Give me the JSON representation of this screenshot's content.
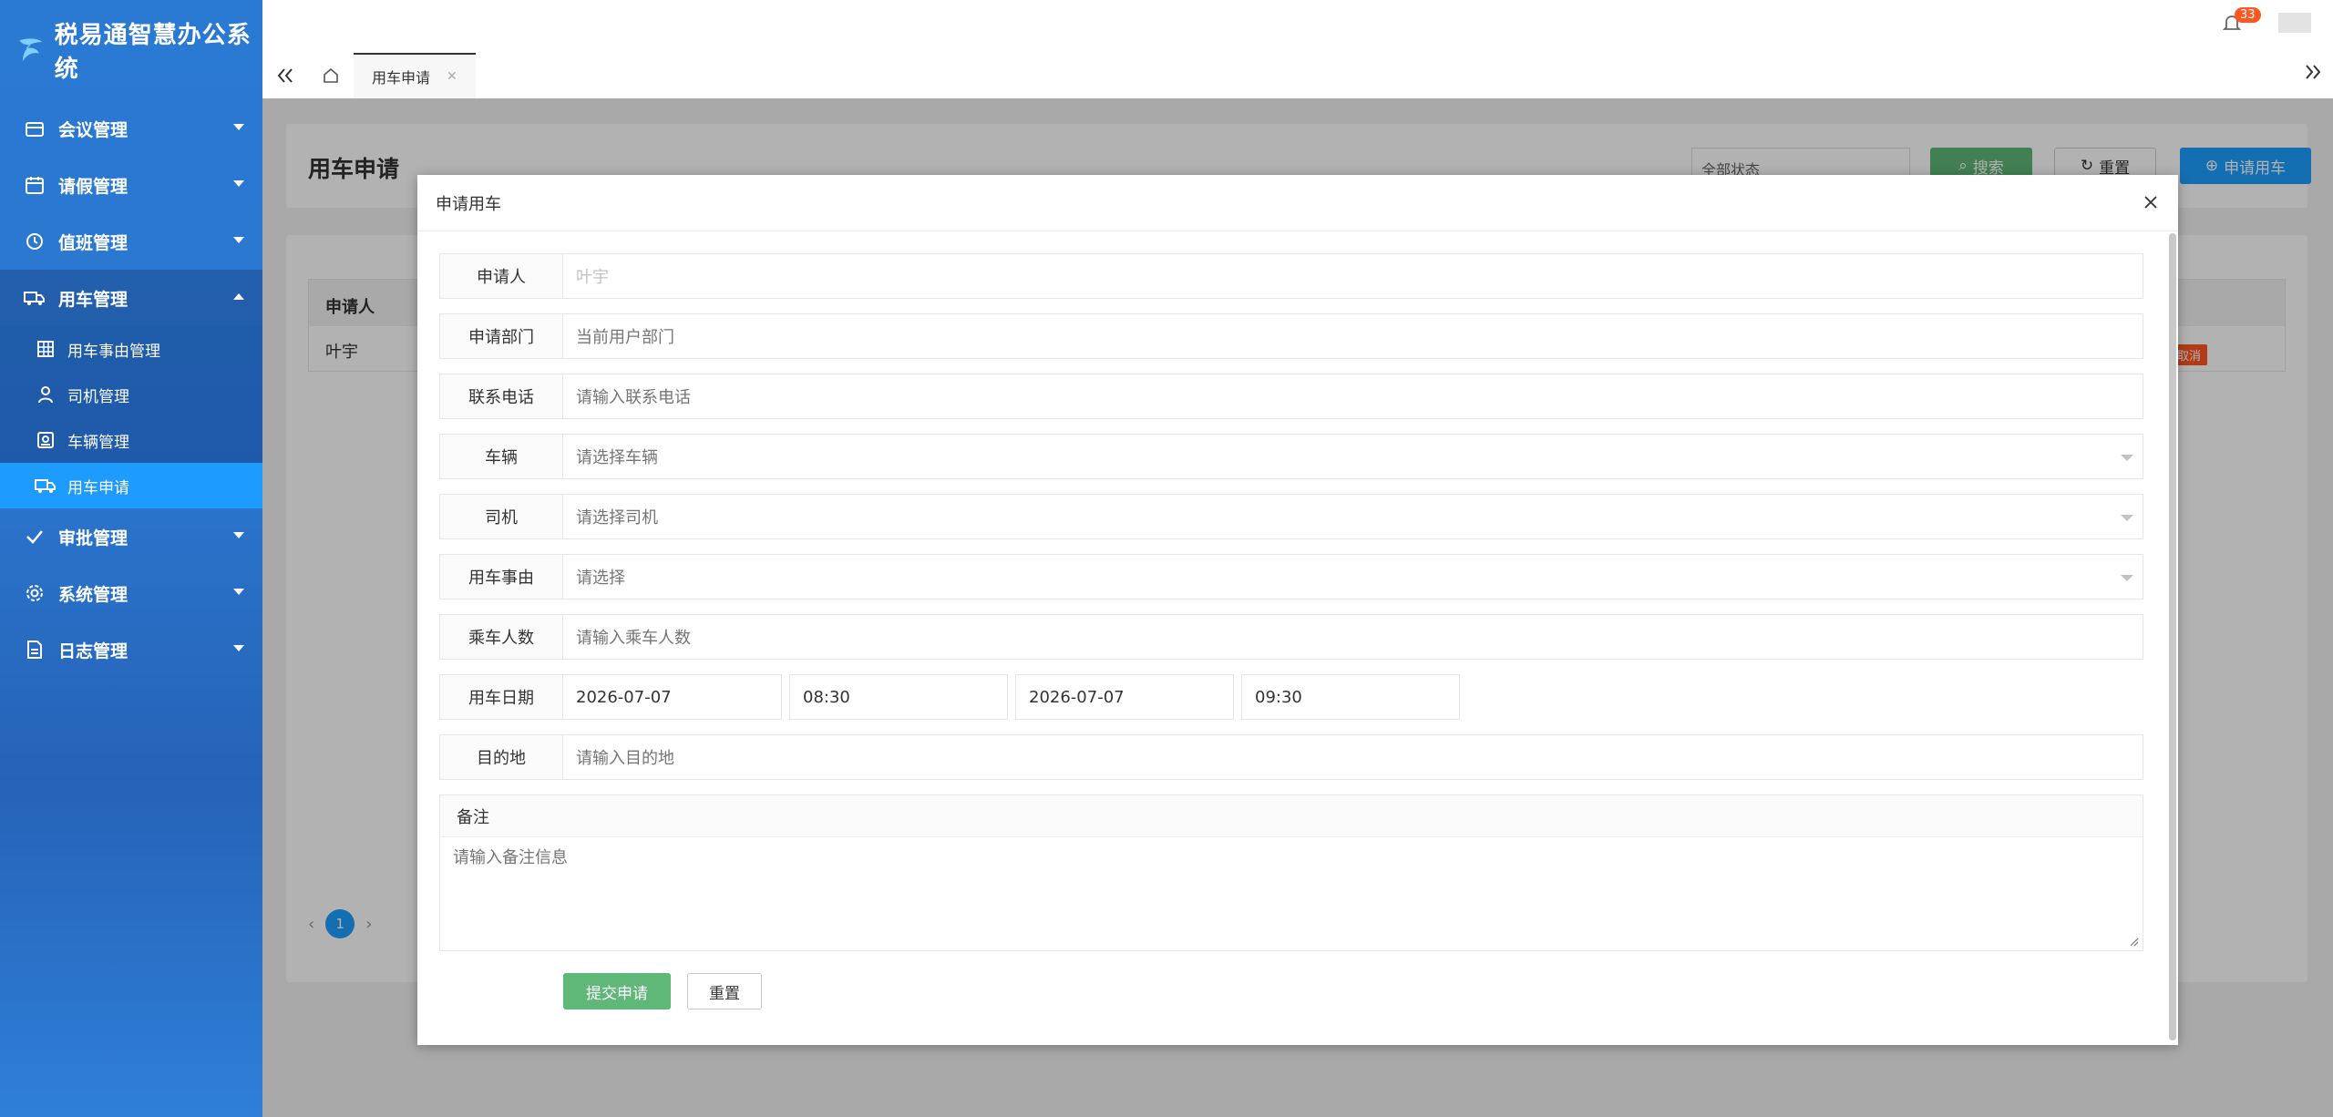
{
  "app": {
    "title": "税易通智慧办公系统"
  },
  "sidebar": {
    "items": [
      {
        "label": "会议管理",
        "icon": "calendar-icon"
      },
      {
        "label": "请假管理",
        "icon": "calendar-grid-icon"
      },
      {
        "label": "值班管理",
        "icon": "clock-icon"
      },
      {
        "label": "用车管理",
        "icon": "truck-icon"
      },
      {
        "label": "审批管理",
        "icon": "check-icon"
      },
      {
        "label": "系统管理",
        "icon": "gear-icon"
      },
      {
        "label": "日志管理",
        "icon": "document-icon"
      }
    ],
    "sub_items": [
      {
        "label": "用车事由管理",
        "icon": "table-icon"
      },
      {
        "label": "司机管理",
        "icon": "user-icon"
      },
      {
        "label": "车辆管理",
        "icon": "vehicle-card-icon"
      },
      {
        "label": "用车申请",
        "icon": "truck-icon"
      }
    ]
  },
  "topbar": {
    "tab_label": "用车申请",
    "notification_count": "33"
  },
  "page": {
    "title": "用车申请",
    "status_filter": "全部状态",
    "search_label": "搜索",
    "reset_label": "重置",
    "apply_label": "申请用车",
    "table_header": "申请人",
    "table_cell": "叶宇",
    "cancel_tag": "取消",
    "page_number": "1"
  },
  "modal": {
    "title": "申请用车",
    "fields": {
      "applicant": {
        "label": "申请人",
        "placeholder": "叶宇"
      },
      "department": {
        "label": "申请部门",
        "value": "当前用户部门"
      },
      "phone": {
        "label": "联系电话",
        "placeholder": "请输入联系电话"
      },
      "vehicle": {
        "label": "车辆",
        "placeholder": "请选择车辆"
      },
      "driver": {
        "label": "司机",
        "placeholder": "请选择司机"
      },
      "reason": {
        "label": "用车事由",
        "placeholder": "请选择"
      },
      "passengers": {
        "label": "乘车人数",
        "placeholder": "请输入乘车人数"
      },
      "date": {
        "label": "用车日期",
        "start_date": "2026-07-07",
        "start_time": "08:30",
        "end_date": "2026-07-07",
        "end_time": "09:30"
      },
      "destination": {
        "label": "目的地",
        "placeholder": "请输入目的地"
      },
      "remark": {
        "label": "备注",
        "placeholder": "请输入备注信息"
      }
    },
    "submit_label": "提交申请",
    "reset_label": "重置"
  }
}
